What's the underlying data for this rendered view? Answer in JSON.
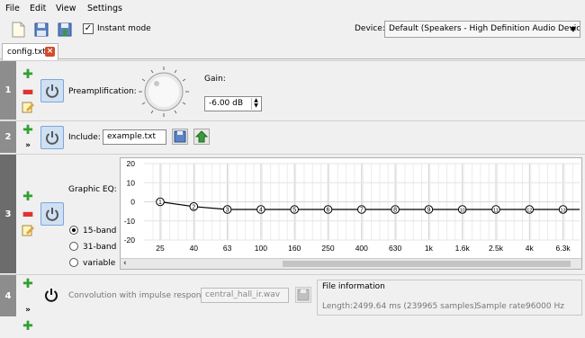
{
  "menu": [
    "File",
    "Edit",
    "View",
    "Settings"
  ],
  "toolbar": {
    "icons": [
      "new-file-icon",
      "save-icon",
      "export-icon"
    ],
    "instant_mode_label": "Instant mode",
    "instant_mode_checked": true,
    "device_label": "Device:",
    "device_value": "Default (Speakers - High Definition Audio Device)"
  },
  "tab": {
    "label": "config.txt"
  },
  "rows": {
    "r1": {
      "num": "1",
      "preamp_label": "Preamplification:",
      "gain_label": "Gain:",
      "gain_value": "-6.00 dB"
    },
    "r2": {
      "num": "2",
      "include_label": "Include:",
      "include_value": "example.txt"
    },
    "r3": {
      "num": "3",
      "eq_label": "Graphic EQ:",
      "bands": [
        {
          "label": "15-band",
          "selected": true
        },
        {
          "label": "31-band",
          "selected": false
        },
        {
          "label": "variable",
          "selected": false
        }
      ]
    },
    "r4": {
      "num": "4",
      "conv_label": "Convolution with impulse response:",
      "conv_value": "central_hall_ir.wav",
      "file_info_title": "File information",
      "length_label": "Length:",
      "length_value": "2499.64 ms (239965 samples)",
      "rate_label": "Sample rate:",
      "rate_value": "96000 Hz"
    }
  },
  "chart_data": {
    "type": "line",
    "title": "",
    "xlabel": "",
    "ylabel": "",
    "x": [
      "25",
      "40",
      "63",
      "100",
      "160",
      "250",
      "400",
      "630",
      "1k",
      "1.6k",
      "2.5k",
      "4k",
      "6.3k"
    ],
    "y_ticks": [
      20,
      10,
      0,
      -10,
      -20
    ],
    "ylim": [
      -20,
      20
    ],
    "grid": true,
    "series": [
      {
        "values": [
          0,
          -2.5,
          -4,
          -4,
          -4,
          -4,
          -4,
          -4,
          -4,
          -4,
          -4,
          -4,
          -4
        ],
        "points": [
          "1",
          "2",
          "3",
          "4",
          "5",
          "6",
          "7",
          "8",
          "9",
          "10",
          "11",
          "12",
          "13"
        ]
      }
    ]
  }
}
